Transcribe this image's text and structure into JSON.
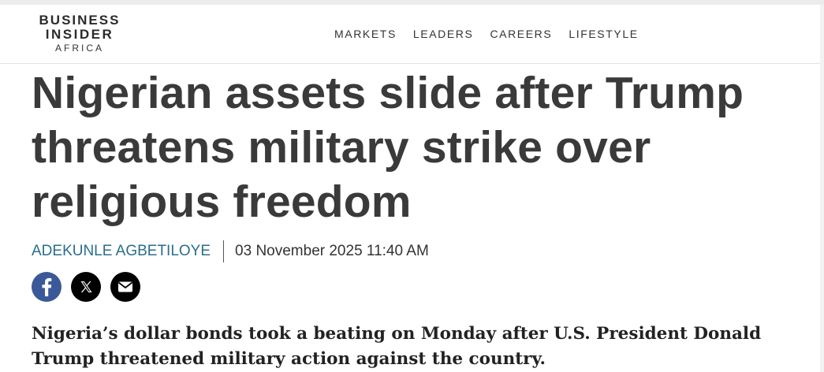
{
  "logo": {
    "line1": "BUSINESS",
    "line2": "INSIDER",
    "line3": "AFRICA"
  },
  "nav": {
    "items": [
      {
        "label": "MARKETS"
      },
      {
        "label": "LEADERS"
      },
      {
        "label": "CAREERS"
      },
      {
        "label": "LIFESTYLE"
      }
    ]
  },
  "article": {
    "headline": "Nigerian assets slide after Trump threatens military strike over religious freedom",
    "author": "ADEKUNLE AGBETILOYE",
    "date": "03 November 2025 11:40 AM",
    "lead": "Nigeria’s dollar bonds took a beating on Monday after U.S. President Donald Trump threatened military action against the country."
  },
  "share": {
    "items": [
      {
        "icon": "facebook-icon",
        "color": "#3b5998"
      },
      {
        "icon": "x-icon",
        "color": "#000000"
      },
      {
        "icon": "email-icon",
        "color": "#000000"
      }
    ]
  },
  "colors": {
    "author_link": "#2a6e8c",
    "headline": "#3a3a3a"
  }
}
